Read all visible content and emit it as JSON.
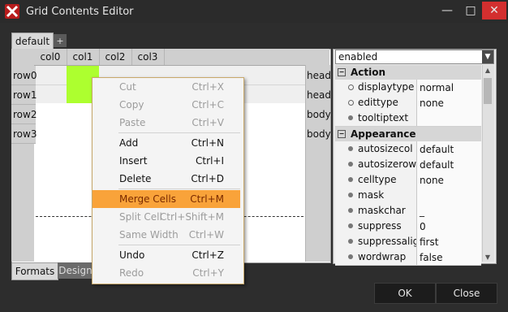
{
  "window": {
    "title": "Grid Contents Editor"
  },
  "window_buttons": {
    "minimize": "—",
    "maximize": "□",
    "close": "✕"
  },
  "tabs": {
    "top": [
      "default"
    ],
    "add_label": "+",
    "bottom": [
      "Formats",
      "Design"
    ]
  },
  "grid": {
    "columns": [
      "col0",
      "col1",
      "col2",
      "col3"
    ],
    "rows": [
      "row0",
      "row1",
      "row2",
      "row3"
    ],
    "row_types": [
      "head",
      "head",
      "body",
      "body"
    ]
  },
  "properties": {
    "selector_value": "enabled",
    "groups": [
      {
        "name": "Action",
        "items": [
          {
            "name": "displaytype",
            "value": "normal"
          },
          {
            "name": "edittype",
            "value": "none"
          },
          {
            "name": "tooltiptext",
            "value": ""
          }
        ]
      },
      {
        "name": "Appearance",
        "items": [
          {
            "name": "autosizecol",
            "value": "default"
          },
          {
            "name": "autosizerow",
            "value": "default"
          },
          {
            "name": "celltype",
            "value": "none"
          },
          {
            "name": "mask",
            "value": ""
          },
          {
            "name": "maskchar",
            "value": "_"
          },
          {
            "name": "suppress",
            "value": "0"
          },
          {
            "name": "suppressalig",
            "value": "first"
          },
          {
            "name": "wordwrap",
            "value": "false"
          }
        ]
      }
    ]
  },
  "context_menu": [
    {
      "label": "Cut",
      "shortcut": "Ctrl+X",
      "enabled": false
    },
    {
      "label": "Copy",
      "shortcut": "Ctrl+C",
      "enabled": false
    },
    {
      "label": "Paste",
      "shortcut": "Ctrl+V",
      "enabled": false
    },
    {
      "label": "Add",
      "shortcut": "Ctrl+N",
      "enabled": true
    },
    {
      "label": "Insert",
      "shortcut": "Ctrl+I",
      "enabled": true
    },
    {
      "label": "Delete",
      "shortcut": "Ctrl+D",
      "enabled": true
    },
    {
      "label": "Merge Cells",
      "shortcut": "Ctrl+M",
      "enabled": true,
      "highlighted": true
    },
    {
      "label": "Split Cell",
      "shortcut": "Ctrl+Shift+M",
      "enabled": false
    },
    {
      "label": "Same Width",
      "shortcut": "Ctrl+W",
      "enabled": false
    },
    {
      "label": "Undo",
      "shortcut": "Ctrl+Z",
      "enabled": true
    },
    {
      "label": "Redo",
      "shortcut": "Ctrl+Y",
      "enabled": false
    }
  ],
  "buttons": {
    "ok": "OK",
    "close": "Close"
  },
  "colors": {
    "accent": "#f9a33a",
    "selected_cell": "#adff2f",
    "close_button": "#d32f2f"
  }
}
